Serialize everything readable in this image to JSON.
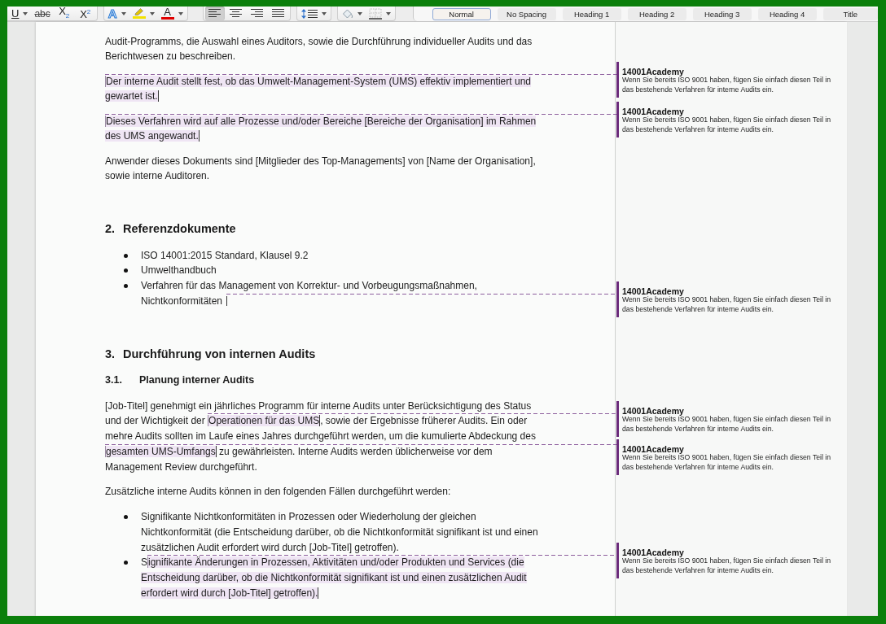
{
  "toolbar": {
    "groups": [
      {
        "tools": [
          {
            "kind": "underline",
            "label": "U",
            "menu": true
          },
          {
            "kind": "strikethrough",
            "label": "abc",
            "menu": false
          },
          {
            "kind": "subscript",
            "label": "X$_{2}$",
            "menu": false
          },
          {
            "kind": "superscript",
            "label": "X$^{2}$",
            "menu": false
          }
        ]
      },
      {
        "tools": [
          {
            "kind": "text-effects",
            "label": "A",
            "menu": true
          },
          {
            "kind": "highlight",
            "color": "#f2e200",
            "menu": true
          },
          {
            "kind": "font-color",
            "label": "A",
            "color": "#e00000",
            "menu": true
          }
        ]
      },
      {
        "tools": [
          {
            "kind": "align-left",
            "selected": true,
            "menu": false
          },
          {
            "kind": "align-center",
            "selected": false,
            "menu": false
          },
          {
            "kind": "align-right",
            "selected": false,
            "menu": false
          },
          {
            "kind": "justify",
            "selected": false,
            "menu": false
          }
        ]
      },
      {
        "tools": [
          {
            "kind": "line-spacing",
            "menu": true
          }
        ]
      },
      {
        "tools": [
          {
            "kind": "shading",
            "menu": true
          },
          {
            "kind": "borders",
            "menu": true
          }
        ]
      }
    ],
    "styles": [
      {
        "label": "Normal",
        "selected": true
      },
      {
        "label": "No Spacing",
        "selected": false
      },
      {
        "label": "Heading 1",
        "selected": false
      },
      {
        "label": "Heading 2",
        "selected": false
      },
      {
        "label": "Heading 3",
        "selected": false
      },
      {
        "label": "Heading 4",
        "selected": false
      },
      {
        "label": "Title",
        "selected": false
      }
    ]
  },
  "document": {
    "blocks": [
      {
        "kind": "paragraph",
        "runs": [
          {
            "text": "Audit-Programms, die Auswahl eines Auditors, sowie die Durchführung individueller Audits und das Berichtwesen zu beschreiben."
          }
        ]
      },
      {
        "kind": "paragraph",
        "runs": [
          {
            "text": "Der interne Audit stellt fest, ob das Umwelt-Management-System (UMS) effektiv implementiert und gewartet ist.",
            "comment": {
              "author": "14001Academy",
              "text": "Wenn Sie bereits ISO 9001 haben, fügen Sie einfach diesen Teil in das bestehende Verfahren für interne Audits ein."
            }
          }
        ]
      },
      {
        "kind": "paragraph",
        "runs": [
          {
            "text": "Dieses Verfahren wird auf alle Prozesse und/oder Bereiche [Bereiche der Organisation] im Rahmen des UMS angewandt.",
            "comment": {
              "author": "14001Academy",
              "text": "Wenn Sie bereits ISO 9001 haben, fügen Sie einfach diesen Teil in das bestehende Verfahren für interne Audits ein."
            }
          }
        ]
      },
      {
        "kind": "paragraph",
        "runs": [
          {
            "text": "Anwender dieses Dokuments sind [Mitglieder des Top-Managements] von [Name der Organisation], sowie interne Auditoren."
          }
        ]
      },
      {
        "kind": "heading",
        "number": "2.",
        "text": "Referenzdokumente"
      },
      {
        "kind": "list",
        "items": [
          {
            "runs": [
              {
                "text": "ISO 14001:2015 Standard, Klausel 9.2"
              }
            ]
          },
          {
            "runs": [
              {
                "text": "Umwelthandbuch"
              }
            ]
          },
          {
            "runs": [
              {
                "text": "Verfahren für das Management von Korrektur- und Vorbeugungsmaßnahmen, Nichtkonformitäten"
              },
              {
                "comment": {
                  "author": "14001Academy",
                  "text": "Wenn Sie bereits ISO 9001 haben, fügen Sie einfach diesen Teil in das bestehende Verfahren für interne Audits ein."
                }
              }
            ]
          }
        ]
      },
      {
        "kind": "heading",
        "number": "3.",
        "text": "Durchführung von internen Audits"
      },
      {
        "kind": "subheading",
        "number": "3.1.",
        "text": "Planung interner Audits"
      },
      {
        "kind": "paragraph",
        "runs": [
          {
            "text": "[Job-Titel] genehmigt ein jährliches Programm für interne Audits unter Berücksichtigung des Status und der Wichtigkeit der "
          },
          {
            "text": "Operationen für das UMS",
            "comment": {
              "author": "14001Academy",
              "text": "Wenn Sie bereits ISO 9001 haben, fügen Sie einfach diesen Teil in das bestehende Verfahren für interne Audits ein."
            }
          },
          {
            "text": ", sowie der Ergebnisse früherer Audits. Ein oder mehre Audits sollten im Laufe eines Jahres durchgeführt werden, um die kumulierte Abdeckung des "
          },
          {
            "text": "gesamten UMS-Umfangs",
            "comment": {
              "author": "14001Academy",
              "text": "Wenn Sie bereits ISO 9001 haben, fügen Sie einfach diesen Teil in das bestehende Verfahren für interne Audits ein."
            }
          },
          {
            "text": " zu gewährleisten. Interne Audits werden üblicherweise vor dem Management Review durchgeführt."
          }
        ]
      },
      {
        "kind": "paragraph",
        "runs": [
          {
            "text": "Zusätzliche interne Audits können in den folgenden Fällen durchgeführt werden:"
          }
        ]
      },
      {
        "kind": "list",
        "items": [
          {
            "runs": [
              {
                "text": "Signifikante Nichtkonformitäten in Prozessen oder Wiederholung der gleichen Nichtkonformität (die Entscheidung darüber, ob die Nichtkonformität signifikant ist und einen zusätzlichen Audit erfordert wird durch [Job-Titel] getroffen)."
              }
            ]
          },
          {
            "runs": [
              {
                "text": "S"
              },
              {
                "text": "ignifikante Änderungen in Prozessen, Aktivitäten und/oder Produkten und Services (die Entscheidung darüber, ob die Nichtkonformität signifikant ist und einen zusätzlichen Audit erfordert wird durch [Job-Titel] getroffen).",
                "comment": {
                  "author": "14001Academy",
                  "text": "Wenn Sie bereits ISO 9001 haben, fügen Sie einfach diesen Teil in das bestehende Verfahren für interne Audits ein."
                }
              }
            ]
          }
        ]
      }
    ]
  }
}
